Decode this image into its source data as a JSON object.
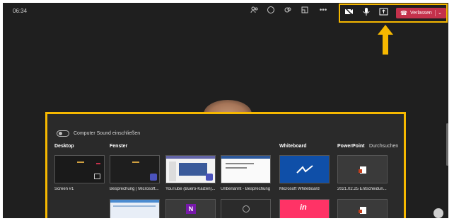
{
  "header": {
    "time": "06:34",
    "leave_label": "Verlassen"
  },
  "share_panel": {
    "toggle_label": "Computer Sound einschließen",
    "sections": {
      "desktop": "Desktop",
      "window": "Fenster",
      "whiteboard": "Whiteboard",
      "powerpoint": "PowerPoint",
      "browse": "Durchsuchen"
    },
    "captions": {
      "screen": "Screen #1",
      "meeting": "Besprechung | Microsoft...",
      "youtube": "YouTube (Buero-Kaizen)...",
      "unnamed": "Unbenannt - Besprechung",
      "whiteboard": "Microsoft Whiteboard",
      "pptfile": "2021.02.25 Entscheidun..."
    }
  },
  "colors": {
    "highlight": "#f6b800",
    "leave": "#c4314b",
    "background": "#1f1f1f"
  }
}
